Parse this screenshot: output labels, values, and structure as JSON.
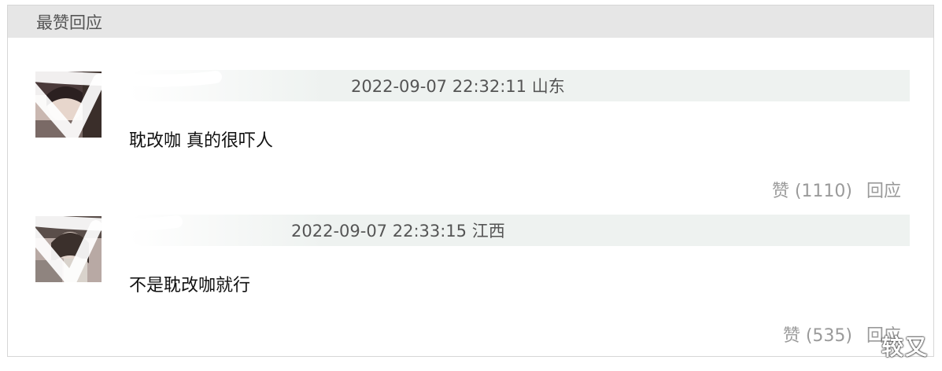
{
  "panel": {
    "title": "最赞回应"
  },
  "comments": [
    {
      "meta": "2022-09-07 22:32:11 山东",
      "text": "耽改咖 真的很吓人",
      "like_label": "赞 (1110)",
      "reply_label": "回应"
    },
    {
      "meta": "2022-09-07 22:33:15 江西",
      "text": "不是耽改咖就行",
      "like_label": "赞 (535)",
      "reply_label": "回应"
    }
  ],
  "watermark": "较又",
  "icons": {
    "avatar_1": "user-avatar-icon",
    "avatar_2": "user-avatar-icon"
  },
  "colors": {
    "header_bg": "#e6e6e6",
    "name_bar_bg": "#eef2f0",
    "action_text": "#9a9a9a"
  }
}
